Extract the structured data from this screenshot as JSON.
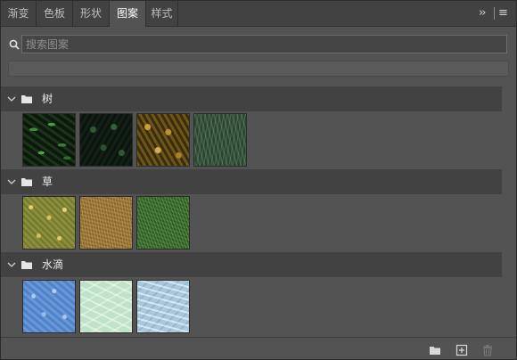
{
  "tabs": [
    {
      "label": "渐变",
      "active": false
    },
    {
      "label": "色板",
      "active": false
    },
    {
      "label": "形状",
      "active": false
    },
    {
      "label": "图案",
      "active": true
    },
    {
      "label": "样式",
      "active": false
    }
  ],
  "toolbar_icons": [
    "collapse-icon",
    "panel-menu-icon"
  ],
  "search": {
    "placeholder": "搜索图案",
    "value": ""
  },
  "groups": [
    {
      "name": "树",
      "expanded": true,
      "patterns": [
        "fern-pattern",
        "dark-leaf-pattern",
        "autumn-leaf-pattern",
        "pine-pattern"
      ]
    },
    {
      "name": "草",
      "expanded": true,
      "patterns": [
        "yellow-grass-pattern",
        "dry-grass-pattern",
        "green-grass-pattern"
      ]
    },
    {
      "name": "水滴",
      "expanded": true,
      "patterns": [
        "blue-water-drop-pattern",
        "pool-water-pattern",
        "ripple-water-pattern"
      ]
    }
  ],
  "bottom_actions": [
    "new-group-icon",
    "new-pattern-icon",
    "delete-icon"
  ],
  "colors": {
    "panel": "#535353",
    "header": "#424242",
    "tabbar": "#424242",
    "text": "#d6d6d6"
  }
}
